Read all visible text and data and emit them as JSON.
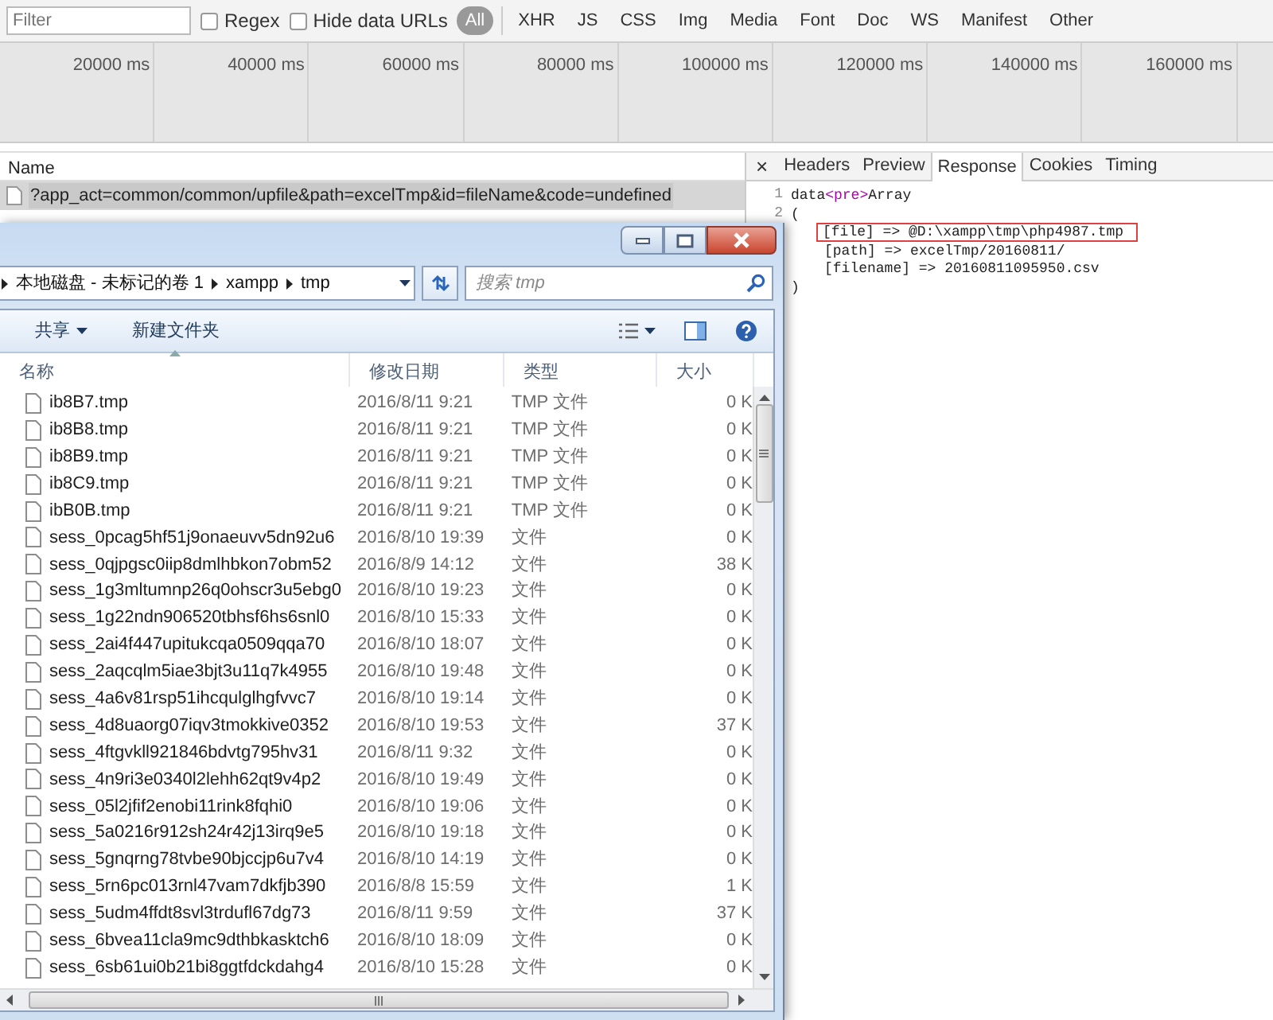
{
  "toolbar": {
    "filter": {
      "placeholder": "Filter"
    },
    "checkboxes": [
      {
        "label": "Regex",
        "checked": false
      },
      {
        "label": "Hide data URLs",
        "checked": false
      }
    ],
    "types": [
      {
        "label": "All",
        "selected": true
      },
      {
        "label": "XHR",
        "selected": false
      },
      {
        "label": "JS",
        "selected": false
      },
      {
        "label": "CSS",
        "selected": false
      },
      {
        "label": "Img",
        "selected": false
      },
      {
        "label": "Media",
        "selected": false
      },
      {
        "label": "Font",
        "selected": false
      },
      {
        "label": "Doc",
        "selected": false
      },
      {
        "label": "WS",
        "selected": false
      },
      {
        "label": "Manifest",
        "selected": false
      },
      {
        "label": "Other",
        "selected": false
      }
    ]
  },
  "timeline": {
    "ticks": [
      "20000 ms",
      "40000 ms",
      "60000 ms",
      "80000 ms",
      "100000 ms",
      "120000 ms",
      "140000 ms",
      "160000 ms"
    ]
  },
  "requests": {
    "header": "Name",
    "rows": [
      {
        "name": "?app_act=common/common/upfile&path=excelTmp&id=fileName&code=undefined",
        "selected": true
      }
    ]
  },
  "detail": {
    "close": "×",
    "tabs": [
      {
        "label": "Headers",
        "selected": false
      },
      {
        "label": "Preview",
        "selected": false
      },
      {
        "label": "Response",
        "selected": true
      },
      {
        "label": "Cookies",
        "selected": false
      },
      {
        "label": "Timing",
        "selected": false
      }
    ],
    "lines": [
      {
        "number": "1",
        "indented": false,
        "highlighted": false,
        "segments": [
          {
            "text": "data",
            "kind": "plain"
          },
          {
            "text": "<pre>",
            "kind": "tag"
          },
          {
            "text": "Array",
            "kind": "plain"
          }
        ]
      },
      {
        "number": "2",
        "indented": false,
        "highlighted": false,
        "segments": [
          {
            "text": "(",
            "kind": "plain"
          }
        ]
      },
      {
        "indented": true,
        "highlighted": true,
        "segments": [
          {
            "text": "[file] => @D:\\xampp\\tmp\\php4987.tmp",
            "kind": "plain"
          }
        ]
      },
      {
        "indented": true,
        "highlighted": false,
        "segments": [
          {
            "text": "[path] => excelTmp/20160811/",
            "kind": "plain"
          }
        ]
      },
      {
        "indented": true,
        "highlighted": false,
        "segments": [
          {
            "text": "[filename] => 20160811095950.csv",
            "kind": "plain"
          }
        ]
      },
      {
        "indented": false,
        "highlighted": false,
        "segments": [
          {
            "text": ")",
            "kind": "plain"
          }
        ]
      }
    ]
  },
  "explorer": {
    "breadcrumb": [
      "本地磁盘 - 未标记的卷 1",
      "xampp",
      "tmp"
    ],
    "search": {
      "placeholder": "搜索 tmp"
    },
    "commands": [
      {
        "label": "共享",
        "dropdown": true
      },
      {
        "label": "新建文件夹",
        "dropdown": false
      }
    ],
    "columns": [
      {
        "label": "名称",
        "sorted": true
      },
      {
        "label": "修改日期",
        "sorted": false
      },
      {
        "label": "类型",
        "sorted": false
      },
      {
        "label": "大小",
        "sorted": false
      }
    ],
    "files": [
      {
        "name": "ib8B7.tmp",
        "modified": "2016/8/11 9:21",
        "type": "TMP 文件",
        "size": "0 K"
      },
      {
        "name": "ib8B8.tmp",
        "modified": "2016/8/11 9:21",
        "type": "TMP 文件",
        "size": "0 K"
      },
      {
        "name": "ib8B9.tmp",
        "modified": "2016/8/11 9:21",
        "type": "TMP 文件",
        "size": "0 K"
      },
      {
        "name": "ib8C9.tmp",
        "modified": "2016/8/11 9:21",
        "type": "TMP 文件",
        "size": "0 K"
      },
      {
        "name": "ibB0B.tmp",
        "modified": "2016/8/11 9:21",
        "type": "TMP 文件",
        "size": "0 K"
      },
      {
        "name": "sess_0pcag5hf51j9onaeuvv5dn92u6",
        "modified": "2016/8/10 19:39",
        "type": "文件",
        "size": "0 K"
      },
      {
        "name": "sess_0qjpgsc0iip8dmlhbkon7obm52",
        "modified": "2016/8/9 14:12",
        "type": "文件",
        "size": "38 K"
      },
      {
        "name": "sess_1g3mltumnp26q0ohscr3u5ebg0",
        "modified": "2016/8/10 19:23",
        "type": "文件",
        "size": "0 K"
      },
      {
        "name": "sess_1g22ndn906520tbhsf6hs6snl0",
        "modified": "2016/8/10 15:33",
        "type": "文件",
        "size": "0 K"
      },
      {
        "name": "sess_2ai4f447upitukcqa0509qqa70",
        "modified": "2016/8/10 18:07",
        "type": "文件",
        "size": "0 K"
      },
      {
        "name": "sess_2aqcqlm5iae3bjt3u11q7k4955",
        "modified": "2016/8/10 19:48",
        "type": "文件",
        "size": "0 K"
      },
      {
        "name": "sess_4a6v81rsp51ihcqulglhgfvvc7",
        "modified": "2016/8/10 19:14",
        "type": "文件",
        "size": "0 K"
      },
      {
        "name": "sess_4d8uaorg07iqv3tmokkive0352",
        "modified": "2016/8/10 19:53",
        "type": "文件",
        "size": "37 K"
      },
      {
        "name": "sess_4ftgvkll921846bdvtg795hv31",
        "modified": "2016/8/11 9:32",
        "type": "文件",
        "size": "0 K"
      },
      {
        "name": "sess_4n9ri3e0340l2lehh62qt9v4p2",
        "modified": "2016/8/10 19:49",
        "type": "文件",
        "size": "0 K"
      },
      {
        "name": "sess_05l2jfif2enobi11rink8fqhi0",
        "modified": "2016/8/10 19:06",
        "type": "文件",
        "size": "0 K"
      },
      {
        "name": "sess_5a0216r912sh24r42j13irq9e5",
        "modified": "2016/8/10 19:18",
        "type": "文件",
        "size": "0 K"
      },
      {
        "name": "sess_5gnqrng78tvbe90bjccjp6u7v4",
        "modified": "2016/8/10 14:19",
        "type": "文件",
        "size": "0 K"
      },
      {
        "name": "sess_5rn6pc013rnl47vam7dkfjb390",
        "modified": "2016/8/8 15:59",
        "type": "文件",
        "size": "1 K"
      },
      {
        "name": "sess_5udm4ffdt8svl3trdufl67dg73",
        "modified": "2016/8/11 9:59",
        "type": "文件",
        "size": "37 K"
      },
      {
        "name": "sess_6bvea11cla9mc9dthbkasktch6",
        "modified": "2016/8/10 18:09",
        "type": "文件",
        "size": "0 K"
      },
      {
        "name": "sess_6sb61ui0b21bi8ggtfdckdahg4",
        "modified": "2016/8/10 15:28",
        "type": "文件",
        "size": "0 K"
      }
    ]
  }
}
